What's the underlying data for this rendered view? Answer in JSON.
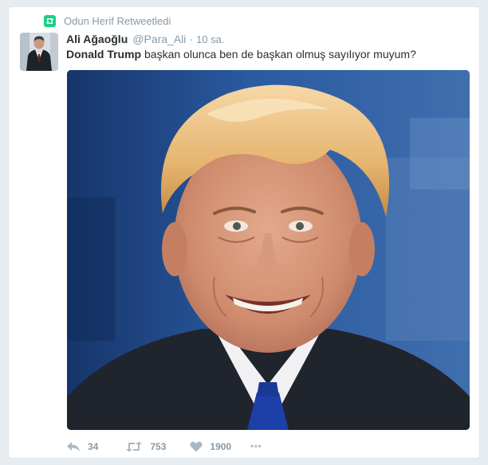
{
  "retweet_context": {
    "text": "Odun Herif Retweetledi",
    "icon": "retweet-icon",
    "icon_color": "#19cf86"
  },
  "tweet": {
    "author": {
      "full_name": "Ali Ağaoğlu",
      "screen_name": "@Para_Ali",
      "avatar": "avatar-photo"
    },
    "separator": "·",
    "timestamp": "10 sa.",
    "text_bold": "Donald Trump",
    "text_rest": " başkan olunca ben de başkan olmuş sayılıyor muyum?",
    "media": {
      "kind": "photo",
      "description_icon": "portrait-photo"
    },
    "actions": {
      "reply": {
        "icon": "reply-icon",
        "count": "34"
      },
      "retweet": {
        "icon": "retweet-icon",
        "count": "753"
      },
      "like": {
        "icon": "heart-icon",
        "count": "1900"
      },
      "more": {
        "icon": "more-icon",
        "label": "•••"
      }
    }
  },
  "colors": {
    "background": "#e6ecf0",
    "text": "#292f33",
    "muted": "#8899a6",
    "retweet_green": "#19cf86"
  }
}
